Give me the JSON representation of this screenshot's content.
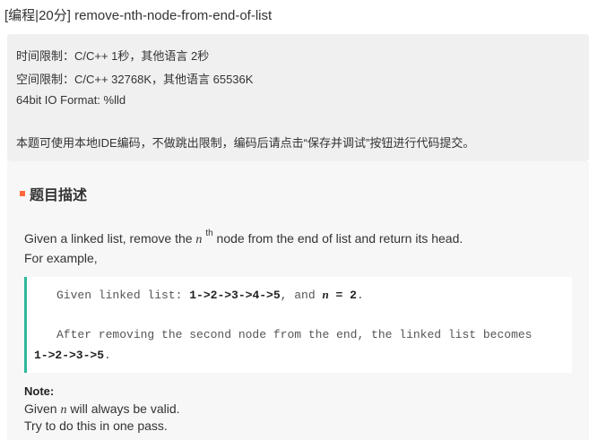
{
  "header": {
    "title": "[编程|20分] remove-nth-node-from-end-of-list"
  },
  "limits": {
    "time": "时间限制：C/C++ 1秒，其他语言 2秒",
    "memory": "空间限制：C/C++ 32768K，其他语言 65536K",
    "format": "64bit IO Format: %lld",
    "note": "本题可使用本地IDE编码，不做跳出限制，编码后请点击“保存并调试”按钮进行代码提交。"
  },
  "section": {
    "heading": "题目描述"
  },
  "description": {
    "line1_a": "Given a linked list, remove the ",
    "n": "n",
    "th": "th",
    "line1_b": " node from the end of list and return its head.",
    "line2": "For example,"
  },
  "code": {
    "l1_a": "Given linked list: ",
    "l1_list": "1->2->3->4->5",
    "l1_b": ", and ",
    "l1_n": "n",
    "l1_c": " = ",
    "l1_val": "2",
    "l1_end": ".",
    "l2": "After removing the second node from the end, the linked list becomes",
    "l3_list": "1->2->3->5",
    "l3_end": "."
  },
  "note": {
    "heading": "Note:",
    "line1_a": "Given ",
    "line1_n": "n",
    "line1_b": " will always be valid.",
    "line2": "Try to do this in one pass."
  },
  "colors": {
    "accent_square": "#ff6a3d",
    "code_border": "#2eb89a",
    "limits_bg": "#f0f0f0"
  }
}
